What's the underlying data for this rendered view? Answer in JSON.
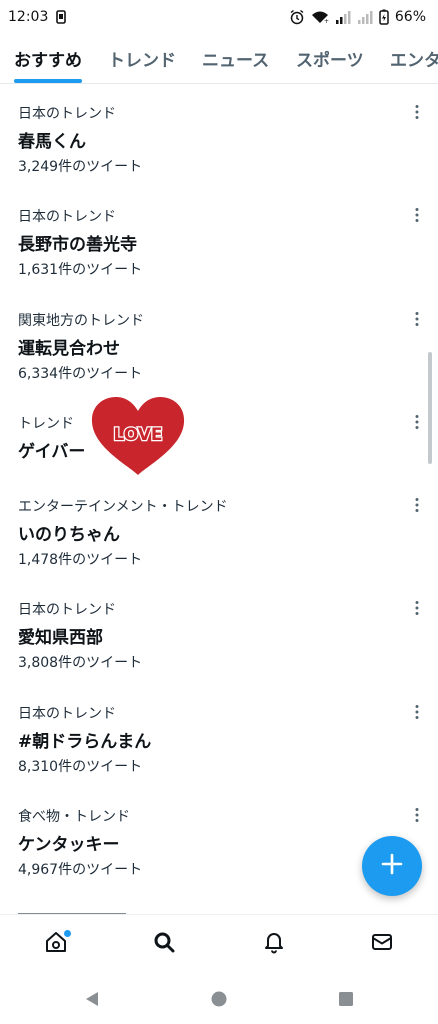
{
  "status_bar": {
    "time": "12:03",
    "battery": "66%",
    "icons": [
      "card-icon",
      "alarm-icon",
      "wifi-icon",
      "signal-icon",
      "signal-icon",
      "battery-icon"
    ]
  },
  "tabs": [
    {
      "label": "おすすめ",
      "active": true
    },
    {
      "label": "トレンド",
      "active": false
    },
    {
      "label": "ニュース",
      "active": false
    },
    {
      "label": "スポーツ",
      "active": false
    },
    {
      "label": "エンタ",
      "active": false
    }
  ],
  "trends": [
    {
      "context": "日本のトレンド",
      "name": "春馬くん",
      "count": "3,249件のツイート"
    },
    {
      "context": "日本のトレンド",
      "name": "長野市の善光寺",
      "count": "1,631件のツイート"
    },
    {
      "context": "関東地方のトレンド",
      "name": "運転見合わせ",
      "count": "6,334件のツイート"
    },
    {
      "context": "トレンド",
      "name": "ゲイバー",
      "count": ""
    },
    {
      "context": "エンターテインメント・トレンド",
      "name": "いのりちゃん",
      "count": "1,478件のツイート"
    },
    {
      "context": "日本のトレンド",
      "name": "愛知県西部",
      "count": "3,808件のツイート"
    },
    {
      "context": "日本のトレンド",
      "name": "#朝ドラらんまん",
      "count": "8,310件のツイート"
    },
    {
      "context": "食べ物・トレンド",
      "name": "ケンタッキー",
      "count": "4,967件のツイート"
    }
  ],
  "sticker": {
    "text": "LOVE",
    "color": "#c8262c"
  },
  "fab": {
    "icon": "plus-icon",
    "color": "#1d9bf0"
  },
  "bottom_nav": [
    {
      "icon": "home-icon",
      "has_dot": true
    },
    {
      "icon": "search-icon",
      "active": true
    },
    {
      "icon": "bell-icon"
    },
    {
      "icon": "mail-icon"
    }
  ],
  "system_nav": [
    "back-icon",
    "home-circle-icon",
    "recents-icon"
  ],
  "colors": {
    "accent": "#1d9bf0",
    "text": "#0f1419",
    "secondary": "#536471"
  }
}
